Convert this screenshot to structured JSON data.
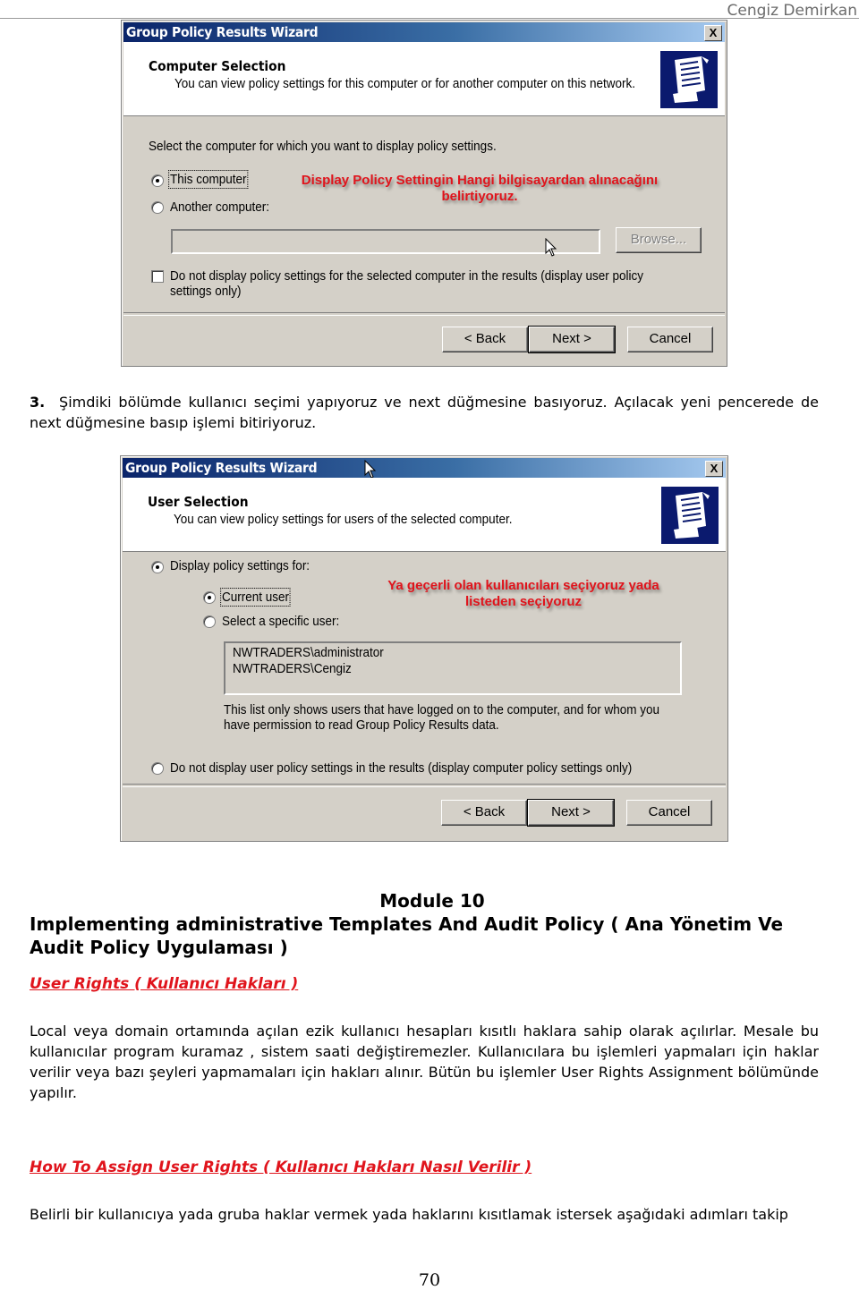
{
  "header": {
    "author": "Cengiz Demirkan"
  },
  "wizard1": {
    "title": "Group Policy Results Wizard",
    "close_label": "X",
    "heading": "Computer Selection",
    "subheading": "You can view policy settings for this computer or for another computer on this network.",
    "logo_icon": "scroll-icon",
    "prompt": "Select the computer for which you want to display policy settings.",
    "radio_this": "This computer",
    "radio_this_selected": true,
    "radio_another": "Another computer:",
    "computer_name_value": "",
    "browse_label": "Browse...",
    "checkbox_label_line1": "Do not display policy settings for the selected computer in the results (display user policy",
    "checkbox_label_line2": "settings only)",
    "checkbox_checked": false,
    "annotation_line1": "Display Policy Settingin Hangi bilgisayardan alınacağını",
    "annotation_line2": "belirtiyoruz.",
    "back_label": "< Back",
    "next_label": "Next >",
    "cancel_label": "Cancel"
  },
  "step3": {
    "number": "3.",
    "text": "Şimdiki bölümde kullanıcı seçimi yapıyoruz ve next düğmesine basıyoruz. Açılacak yeni pencerede de next düğmesine basıp işlemi bitiriyoruz."
  },
  "wizard2": {
    "title": "Group Policy Results Wizard",
    "close_label": "X",
    "heading": "User Selection",
    "subheading": "You can view policy settings for users of the selected computer.",
    "logo_icon": "scroll-icon",
    "radio_display": "Display policy settings for:",
    "radio_current": "Current user",
    "radio_specific": "Select a specific user:",
    "users": [
      "NWTRADERS\\administrator",
      "NWTRADERS\\Cengiz"
    ],
    "list_note_line1": "This list only shows users that have logged on to the computer, and for whom you",
    "list_note_line2": "have permission to read Group Policy Results data.",
    "radio_no_user": "Do not display user policy settings in the results (display computer policy settings only)",
    "annotation_line1": "Ya geçerli olan kullanıcıları seçiyoruz yada",
    "annotation_line2": "listeden seçiyoruz",
    "back_label": "< Back",
    "next_label": "Next >",
    "cancel_label": "Cancel"
  },
  "module": {
    "line1": "Module 10",
    "line2": "Implementing administrative Templates And Audit Policy ( Ana Yönetim Ve",
    "line3": "Audit Policy Uygulaması )"
  },
  "section1": {
    "heading": "User Rights ( Kullanıcı Hakları )",
    "body": "Local veya domain ortamında açılan ezik kullanıcı hesapları kısıtlı haklara sahip olarak açılırlar. Mesale bu kullanıcılar program kuramaz , sistem saati değiştiremezler. Kullanıcılara bu işlemleri yapmaları için haklar verilir veya bazı şeyleri yapmamaları için hakları alınır. Bütün bu işlemler User Rights Assignment bölümünde yapılır."
  },
  "section2": {
    "heading": "How To Assign User Rights ( Kullanıcı Hakları Nasıl Verilir )",
    "body": "Belirli bir kullanıcıya yada gruba haklar vermek yada haklarını kısıtlamak istersek aşağıdaki adımları takip"
  },
  "page_number": "70"
}
